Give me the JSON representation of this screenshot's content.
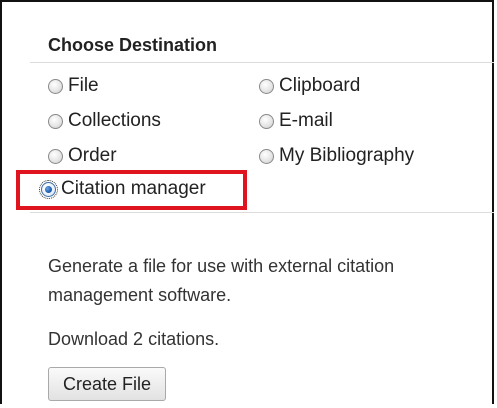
{
  "section": {
    "heading": "Choose Destination"
  },
  "options": {
    "file": "File",
    "clipboard": "Clipboard",
    "collections": "Collections",
    "email": "E-mail",
    "order": "Order",
    "my_bibliography": "My Bibliography",
    "citation_manager": "Citation manager",
    "selected": "Citation manager"
  },
  "details": {
    "description": "Generate a file for use with external citation management software.",
    "download_note": "Download 2 citations.",
    "create_button_label": "Create File"
  },
  "colors": {
    "highlight": "#e0141e",
    "radio_selected": "#1f5fae"
  }
}
